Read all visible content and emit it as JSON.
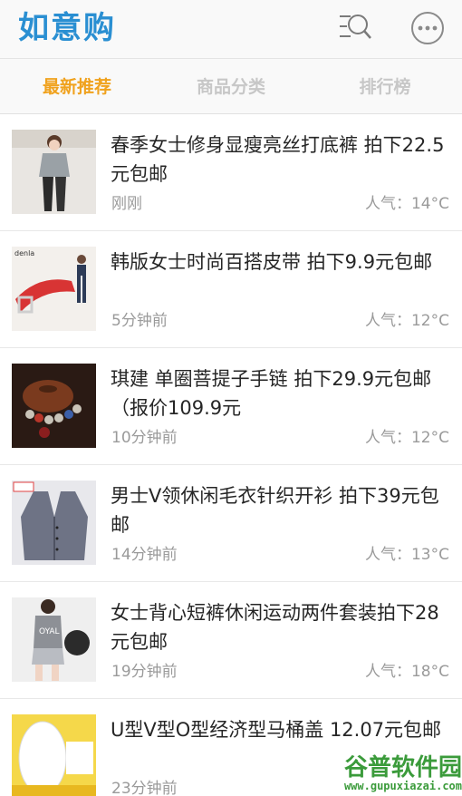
{
  "app": {
    "logo": "如意购"
  },
  "header": {
    "search_icon": "search-list-icon",
    "more_icon": "more-dots-icon"
  },
  "tabs": [
    {
      "label": "最新推荐",
      "active": true
    },
    {
      "label": "商品分类",
      "active": false
    },
    {
      "label": "排行榜",
      "active": false
    }
  ],
  "colors": {
    "brand": "#2a8fd2",
    "active_tab": "#f0a21e",
    "muted": "#9a9a9a"
  },
  "items": [
    {
      "title": "春季女士修身显瘦亮丝打底裤 拍下22.5元包邮",
      "time": "刚刚",
      "hot": "人气：14°C",
      "thumb": "leggings-photo"
    },
    {
      "title": "韩版女士时尚百搭皮带 拍下9.9元包邮",
      "time": "5分钟前",
      "hot": "人气：12°C",
      "thumb": "belt-photo"
    },
    {
      "title": "琪建 单圈菩提子手链 拍下29.9元包邮（报价109.9元",
      "time": "10分钟前",
      "hot": "人气：12°C",
      "thumb": "bracelet-photo"
    },
    {
      "title": "男士V领休闲毛衣针织开衫 拍下39元包邮",
      "time": "14分钟前",
      "hot": "人气：13°C",
      "thumb": "cardigan-photo"
    },
    {
      "title": "女士背心短裤休闲运动两件套装拍下28元包邮",
      "time": "19分钟前",
      "hot": "人气：18°C",
      "thumb": "sport-set-photo"
    },
    {
      "title": "U型V型O型经济型马桶盖 12.07元包邮",
      "time": "23分钟前",
      "hot": "",
      "thumb": "toilet-seat-photo"
    }
  ],
  "watermark": {
    "title": "谷普软件园",
    "url": "www.gupuxiazai.com"
  }
}
